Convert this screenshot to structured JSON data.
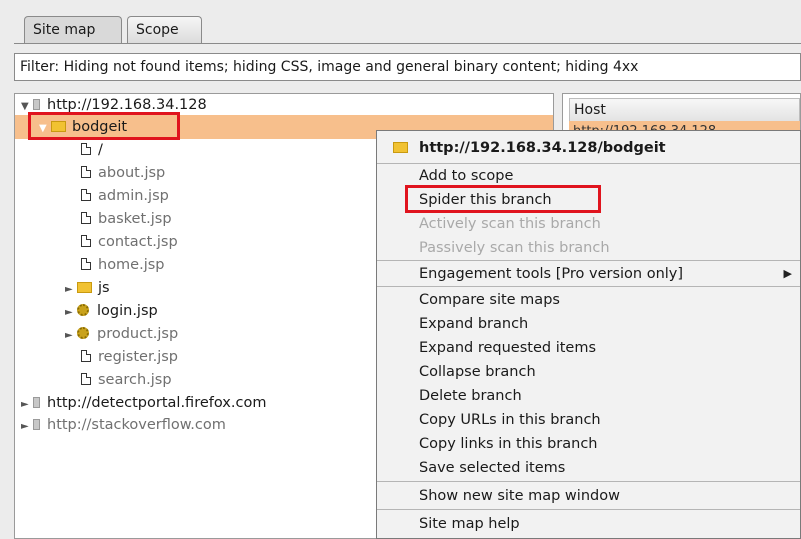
{
  "tabs": [
    {
      "label": "Site map",
      "active": true
    },
    {
      "label": "Scope",
      "active": false
    }
  ],
  "filter": {
    "text": "Filter: Hiding not found items;  hiding CSS, image and general binary content;  hiding 4xx"
  },
  "tree": {
    "root": "http://192.168.34.128",
    "selected_folder": "bodgeit",
    "items": [
      {
        "label": "/",
        "type": "file"
      },
      {
        "label": "about.jsp",
        "type": "file"
      },
      {
        "label": "admin.jsp",
        "type": "file"
      },
      {
        "label": "basket.jsp",
        "type": "file"
      },
      {
        "label": "contact.jsp",
        "type": "file"
      },
      {
        "label": "home.jsp",
        "type": "file"
      },
      {
        "label": "js",
        "type": "folder"
      },
      {
        "label": "login.jsp",
        "type": "gear"
      },
      {
        "label": "product.jsp",
        "type": "gear"
      },
      {
        "label": "register.jsp",
        "type": "file"
      },
      {
        "label": "search.jsp",
        "type": "file"
      }
    ],
    "hosts": [
      {
        "label": "http://detectportal.firefox.com"
      },
      {
        "label": "http://stackoverflow.com"
      }
    ]
  },
  "table": {
    "host_header": "Host",
    "host_row": "http://192.168.34.128"
  },
  "context_menu": {
    "header": "http://192.168.34.128/bodgeit",
    "items": [
      {
        "label": "Add to scope",
        "enabled": true
      },
      {
        "label": "Spider this branch",
        "enabled": true,
        "highlighted": true
      },
      {
        "label": "Actively scan this branch",
        "enabled": false
      },
      {
        "label": "Passively scan this branch",
        "enabled": false
      },
      {
        "label": "Engagement tools [Pro version only]",
        "enabled": true,
        "submenu": true
      },
      {
        "label": "Compare site maps",
        "enabled": true
      },
      {
        "label": "Expand branch",
        "enabled": true
      },
      {
        "label": "Expand requested items",
        "enabled": true
      },
      {
        "label": "Collapse branch",
        "enabled": true
      },
      {
        "label": "Delete branch",
        "enabled": true
      },
      {
        "label": "Copy URLs in this branch",
        "enabled": true
      },
      {
        "label": "Copy links in this branch",
        "enabled": true
      },
      {
        "label": "Save selected items",
        "enabled": true
      },
      {
        "label": "Show new site map window",
        "enabled": true
      },
      {
        "label": "Site map help",
        "enabled": true
      }
    ]
  },
  "colors": {
    "selection": "#f7bf8c",
    "highlight_box": "#e0141e",
    "folder": "#f1c232"
  }
}
